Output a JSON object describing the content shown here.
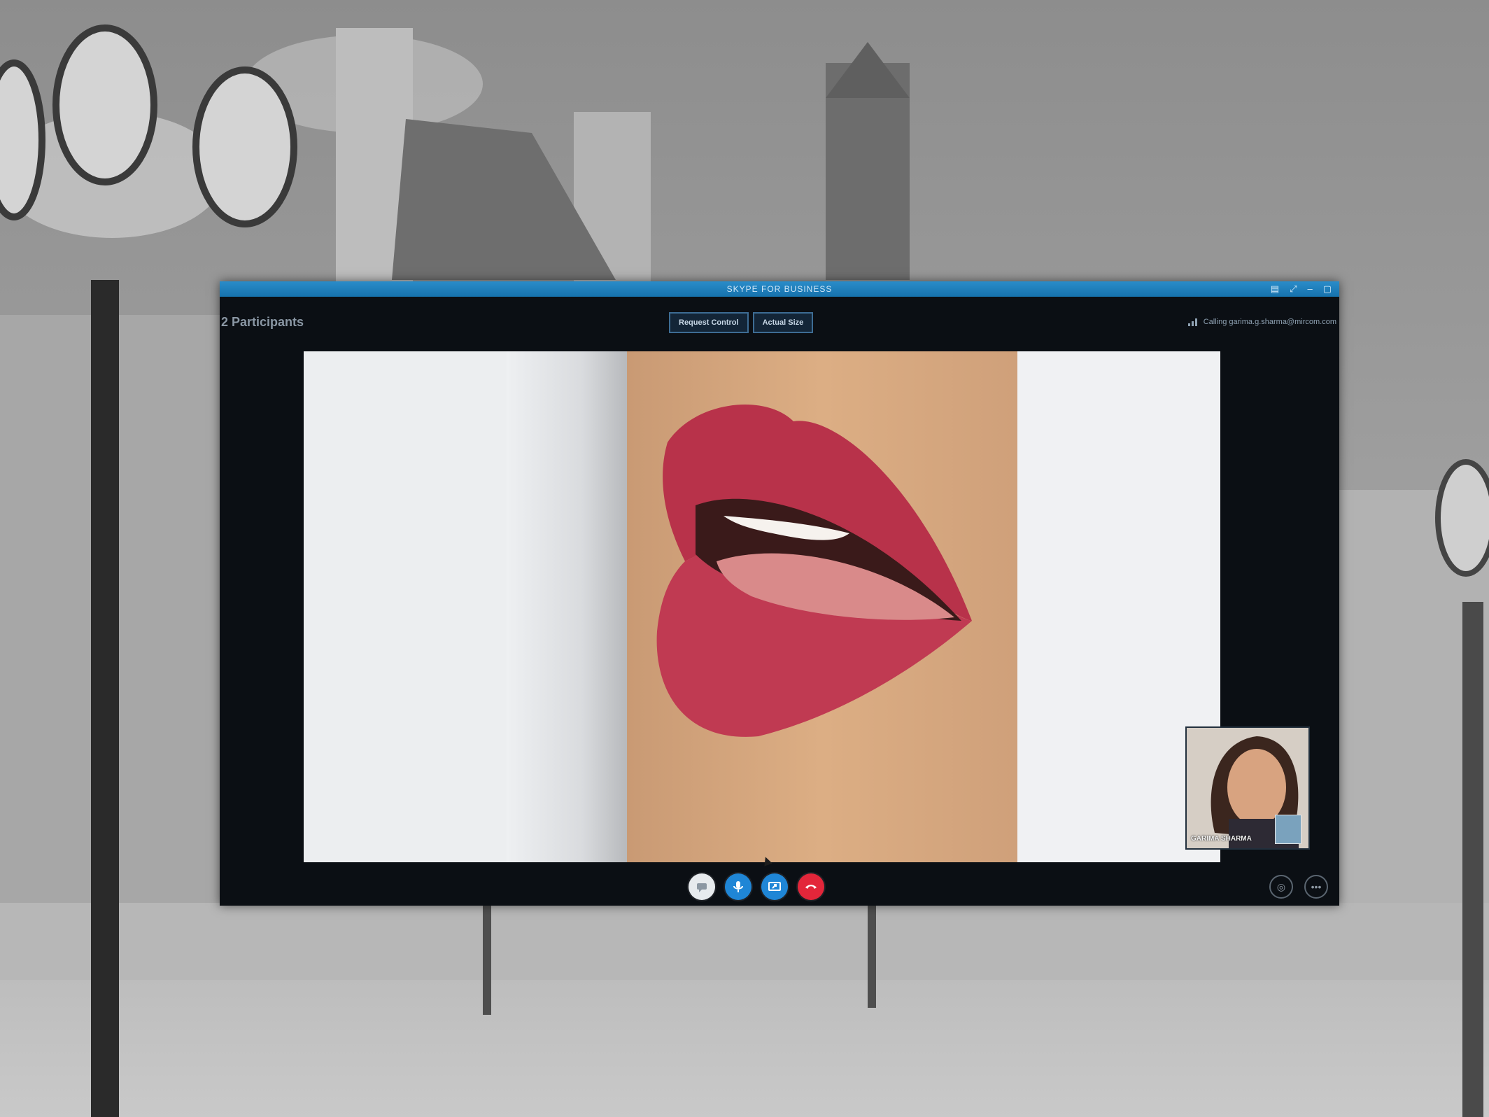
{
  "window": {
    "title": "SKYPE FOR BUSINESS",
    "participants_label": "2 Participants",
    "request_control_label": "Request Control",
    "actual_size_label": "Actual Size",
    "calling_label": "Calling garima.g.sharma@mircom.com"
  },
  "self_view": {
    "name": "GARIMA SHARMA"
  },
  "controls": {
    "chat_icon": "chat-icon",
    "mic_icon": "microphone-icon",
    "share_icon": "share-screen-icon",
    "end_call_icon": "end-call-icon",
    "device_icon": "device-settings-icon",
    "more_icon": "more-options-icon",
    "more_label": "•••",
    "device_label": "◎"
  },
  "colors": {
    "titlebar": "#1f80be",
    "accent_blue": "#1f86d6",
    "end_call_red": "#e3263a",
    "lip_red": "#b8324a"
  },
  "window_controls": [
    "▤",
    "⤢",
    "–",
    "▢"
  ]
}
